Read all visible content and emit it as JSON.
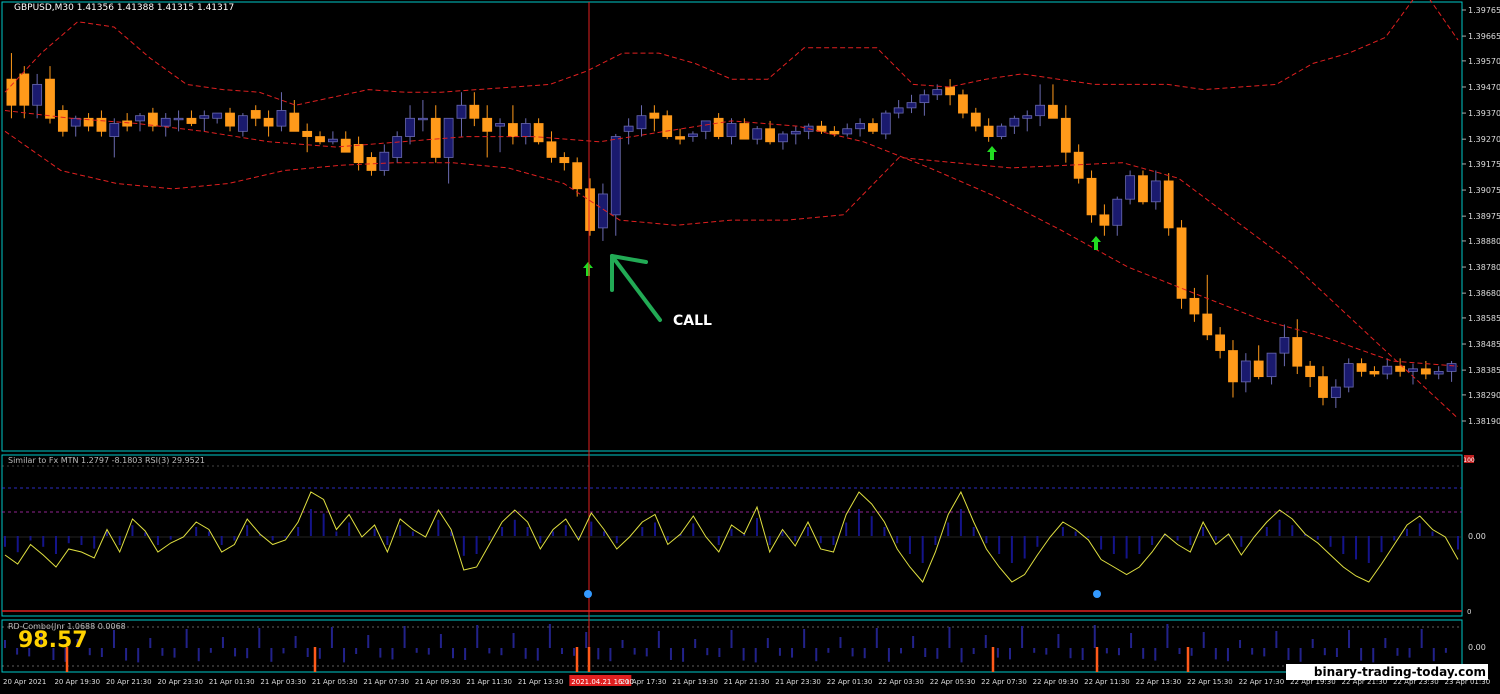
{
  "symbol_header": "GBPUSD,M30  1.41356 1.41388 1.41315 1.41317",
  "call_label": "CALL",
  "watermark": "binary-trading-today.com",
  "sub1_header": "Similar to Fx MTN  1.2797 -8.1803  RSI(3) 29.9521",
  "sub2_header": "RD-Combo(Jnr  1.0688 0.0068",
  "sub2_value": "98.57",
  "price_axis": [
    "1.39765",
    "1.39665",
    "1.39570",
    "1.39470",
    "1.39370",
    "1.39270",
    "1.39175",
    "1.39075",
    "1.38975",
    "1.38880",
    "1.38780",
    "1.38680",
    "1.38585",
    "1.38485",
    "1.38385",
    "1.38290",
    "1.38190"
  ],
  "sub1_axis": [
    "0.00"
  ],
  "sub2_axis": [
    "0.00"
  ],
  "sub1_top_label": "100",
  "sub1_bottom_label": "0",
  "time_axis": [
    "20 Apr 2021",
    "20 Apr 19:30",
    "20 Apr 21:30",
    "20 Apr 23:30",
    "21 Apr 01:30",
    "21 Apr 03:30",
    "21 Apr 05:30",
    "21 Apr 07:30",
    "21 Apr 09:30",
    "21 Apr 11:30",
    "21 Apr 13:30",
    "2021.04.21 16:00",
    "21 Apr 17:30",
    "21 Apr 19:30",
    "21 Apr 21:30",
    "21 Apr 23:30",
    "22 Apr 01:30",
    "22 Apr 03:30",
    "22 Apr 05:30",
    "22 Apr 07:30",
    "22 Apr 09:30",
    "22 Apr 11:30",
    "22 Apr 13:30",
    "22 Apr 15:30",
    "22 Apr 17:30",
    "22 Apr 19:30",
    "22 Apr 21:30",
    "22 Apr 23:30",
    "23 Apr 01:30"
  ],
  "colors": {
    "bull": "#1a1a6e",
    "bear": "#ff9a1a",
    "band": "#e02020",
    "rsi": "#e0e040",
    "grid": "#00c8c8",
    "arrow": "#22dd22",
    "call_arrow": "#22aa55"
  },
  "chart_data": {
    "type": "candlestick",
    "ylim": [
      1.3819,
      1.39765
    ],
    "candles": [
      [
        1.395,
        1.396,
        1.3935,
        1.394
      ],
      [
        1.3952,
        1.3955,
        1.3935,
        1.394
      ],
      [
        1.394,
        1.3952,
        1.3935,
        1.3948
      ],
      [
        1.395,
        1.3955,
        1.3933,
        1.3935
      ],
      [
        1.3938,
        1.394,
        1.3928,
        1.393
      ],
      [
        1.3932,
        1.3936,
        1.3928,
        1.3935
      ],
      [
        1.3935,
        1.3937,
        1.393,
        1.3932
      ],
      [
        1.3935,
        1.3938,
        1.3928,
        1.393
      ],
      [
        1.3928,
        1.3935,
        1.392,
        1.3933
      ],
      [
        1.3934,
        1.3937,
        1.393,
        1.3932
      ],
      [
        1.3934,
        1.3937,
        1.393,
        1.3936
      ],
      [
        1.3937,
        1.3939,
        1.393,
        1.3932
      ],
      [
        1.3932,
        1.3937,
        1.3928,
        1.3935
      ],
      [
        1.3935,
        1.3938,
        1.393,
        1.3935
      ],
      [
        1.3935,
        1.3938,
        1.3932,
        1.3933
      ],
      [
        1.3935,
        1.3938,
        1.393,
        1.3936
      ],
      [
        1.3935,
        1.3937,
        1.3933,
        1.3937
      ],
      [
        1.3937,
        1.3939,
        1.393,
        1.3932
      ],
      [
        1.393,
        1.3937,
        1.3928,
        1.3936
      ],
      [
        1.3938,
        1.394,
        1.3932,
        1.3935
      ],
      [
        1.3935,
        1.3938,
        1.3928,
        1.3932
      ],
      [
        1.3932,
        1.3945,
        1.393,
        1.3938
      ],
      [
        1.3937,
        1.3942,
        1.393,
        1.393
      ],
      [
        1.393,
        1.3933,
        1.3922,
        1.3928
      ],
      [
        1.3928,
        1.393,
        1.3925,
        1.3926
      ],
      [
        1.3926,
        1.393,
        1.3925,
        1.3927
      ],
      [
        1.3927,
        1.393,
        1.3922,
        1.3922
      ],
      [
        1.3925,
        1.3928,
        1.3915,
        1.3918
      ],
      [
        1.392,
        1.3922,
        1.3913,
        1.3915
      ],
      [
        1.3915,
        1.3925,
        1.3913,
        1.3922
      ],
      [
        1.392,
        1.393,
        1.3918,
        1.3928
      ],
      [
        1.3928,
        1.394,
        1.3925,
        1.3935
      ],
      [
        1.3935,
        1.3942,
        1.393,
        1.3935
      ],
      [
        1.3935,
        1.394,
        1.3918,
        1.392
      ],
      [
        1.392,
        1.3935,
        1.391,
        1.3935
      ],
      [
        1.3935,
        1.3945,
        1.3928,
        1.394
      ],
      [
        1.394,
        1.3945,
        1.3932,
        1.3935
      ],
      [
        1.3935,
        1.394,
        1.392,
        1.393
      ],
      [
        1.3932,
        1.3935,
        1.3922,
        1.3933
      ],
      [
        1.3933,
        1.394,
        1.3925,
        1.3928
      ],
      [
        1.3928,
        1.3935,
        1.3925,
        1.3933
      ],
      [
        1.3933,
        1.3935,
        1.3925,
        1.3926
      ],
      [
        1.3926,
        1.393,
        1.3918,
        1.392
      ],
      [
        1.392,
        1.3922,
        1.3915,
        1.3918
      ],
      [
        1.3918,
        1.392,
        1.3905,
        1.3908
      ],
      [
        1.3908,
        1.3912,
        1.389,
        1.3892
      ],
      [
        1.3893,
        1.391,
        1.3888,
        1.3906
      ],
      [
        1.3898,
        1.3929,
        1.389,
        1.3928
      ],
      [
        1.393,
        1.3935,
        1.3925,
        1.3932
      ],
      [
        1.3931,
        1.394,
        1.3928,
        1.3936
      ],
      [
        1.3937,
        1.394,
        1.393,
        1.3935
      ],
      [
        1.3936,
        1.3938,
        1.3927,
        1.3928
      ],
      [
        1.3928,
        1.3931,
        1.3925,
        1.3927
      ],
      [
        1.3928,
        1.393,
        1.3926,
        1.3929
      ],
      [
        1.393,
        1.3934,
        1.3927,
        1.3934
      ],
      [
        1.3935,
        1.3937,
        1.3927,
        1.3928
      ],
      [
        1.3928,
        1.3935,
        1.3925,
        1.3933
      ],
      [
        1.3933,
        1.3935,
        1.3927,
        1.3927
      ],
      [
        1.3927,
        1.3932,
        1.3925,
        1.3931
      ],
      [
        1.3931,
        1.3934,
        1.3925,
        1.3926
      ],
      [
        1.3926,
        1.393,
        1.3923,
        1.3929
      ],
      [
        1.3929,
        1.3932,
        1.3925,
        1.393
      ],
      [
        1.393,
        1.3933,
        1.3927,
        1.3932
      ],
      [
        1.3932,
        1.3934,
        1.3929,
        1.393
      ],
      [
        1.393,
        1.3932,
        1.3928,
        1.3929
      ],
      [
        1.3929,
        1.3933,
        1.3928,
        1.3931
      ],
      [
        1.3931,
        1.3935,
        1.3928,
        1.3933
      ],
      [
        1.3933,
        1.3935,
        1.3929,
        1.393
      ],
      [
        1.3929,
        1.3938,
        1.3927,
        1.3937
      ],
      [
        1.3937,
        1.3942,
        1.3935,
        1.3939
      ],
      [
        1.3939,
        1.3944,
        1.3937,
        1.3941
      ],
      [
        1.3941,
        1.3946,
        1.3936,
        1.3944
      ],
      [
        1.3944,
        1.3948,
        1.3942,
        1.3946
      ],
      [
        1.3947,
        1.395,
        1.394,
        1.3944
      ],
      [
        1.3944,
        1.3946,
        1.3935,
        1.3937
      ],
      [
        1.3937,
        1.3939,
        1.393,
        1.3932
      ],
      [
        1.3932,
        1.3935,
        1.3926,
        1.3928
      ],
      [
        1.3928,
        1.3933,
        1.3927,
        1.3932
      ],
      [
        1.3932,
        1.3936,
        1.3929,
        1.3935
      ],
      [
        1.3935,
        1.3938,
        1.393,
        1.3936
      ],
      [
        1.3936,
        1.3948,
        1.3932,
        1.394
      ],
      [
        1.394,
        1.3948,
        1.3935,
        1.3935
      ],
      [
        1.3935,
        1.394,
        1.3918,
        1.3922
      ],
      [
        1.3922,
        1.3925,
        1.391,
        1.3912
      ],
      [
        1.3912,
        1.3915,
        1.3895,
        1.3898
      ],
      [
        1.3898,
        1.3902,
        1.389,
        1.3894
      ],
      [
        1.3894,
        1.3905,
        1.389,
        1.3904
      ],
      [
        1.3904,
        1.3915,
        1.3902,
        1.3913
      ],
      [
        1.3913,
        1.3915,
        1.3902,
        1.3903
      ],
      [
        1.3903,
        1.3915,
        1.39,
        1.3911
      ],
      [
        1.3911,
        1.3914,
        1.389,
        1.3893
      ],
      [
        1.3893,
        1.3896,
        1.3862,
        1.3866
      ],
      [
        1.3866,
        1.387,
        1.3857,
        1.386
      ],
      [
        1.386,
        1.3875,
        1.385,
        1.3852
      ],
      [
        1.3852,
        1.3855,
        1.3843,
        1.3846
      ],
      [
        1.3846,
        1.385,
        1.3828,
        1.3834
      ],
      [
        1.3834,
        1.3845,
        1.383,
        1.3842
      ],
      [
        1.3842,
        1.3848,
        1.3835,
        1.3836
      ],
      [
        1.3836,
        1.3845,
        1.3833,
        1.3845
      ],
      [
        1.3845,
        1.3856,
        1.384,
        1.3851
      ],
      [
        1.3851,
        1.3858,
        1.3837,
        1.384
      ],
      [
        1.384,
        1.3842,
        1.3832,
        1.3836
      ],
      [
        1.3836,
        1.384,
        1.3825,
        1.3828
      ],
      [
        1.3828,
        1.3835,
        1.3824,
        1.3832
      ],
      [
        1.3832,
        1.3843,
        1.383,
        1.3841
      ],
      [
        1.3841,
        1.3843,
        1.3836,
        1.3838
      ],
      [
        1.3838,
        1.384,
        1.3836,
        1.3837
      ],
      [
        1.3837,
        1.3843,
        1.3835,
        1.384
      ],
      [
        1.384,
        1.3843,
        1.3836,
        1.3838
      ],
      [
        1.3838,
        1.3841,
        1.3833,
        1.3839
      ],
      [
        1.3839,
        1.3842,
        1.3835,
        1.3837
      ],
      [
        1.3837,
        1.384,
        1.3835,
        1.3838
      ],
      [
        1.3838,
        1.3842,
        1.3834,
        1.3841
      ]
    ],
    "band_upper": [
      1.3945,
      1.396,
      1.3972,
      1.397,
      1.3958,
      1.3948,
      1.3946,
      1.3945,
      1.394,
      1.3943,
      1.3946,
      1.3945,
      1.3945,
      1.3946,
      1.3947,
      1.3948,
      1.3953,
      1.396,
      1.396,
      1.3956,
      1.395,
      1.395,
      1.3962,
      1.3962,
      1.3962,
      1.3948,
      1.3947,
      1.395,
      1.3952,
      1.395,
      1.3948,
      1.3948,
      1.3948,
      1.3946,
      1.3947,
      1.3948,
      1.3956,
      1.396,
      1.3966,
      1.3985,
      1.3965
    ],
    "band_lower": [
      1.393,
      1.3915,
      1.391,
      1.3908,
      1.391,
      1.3915,
      1.3917,
      1.3918,
      1.3918,
      1.3916,
      1.391,
      1.3896,
      1.3894,
      1.3896,
      1.3896,
      1.3898,
      1.392,
      1.3918,
      1.3916,
      1.3917,
      1.3918,
      1.3912,
      1.3896,
      1.388,
      1.386,
      1.384,
      1.382
    ],
    "band_mid": [
      1.3938,
      1.3935,
      1.3933,
      1.393,
      1.3926,
      1.3924,
      1.3926,
      1.3928,
      1.3928,
      1.3926,
      1.393,
      1.3934,
      1.3932,
      1.3926,
      1.3916,
      1.3905,
      1.3892,
      1.3878,
      1.3868,
      1.3858,
      1.3851,
      1.3842,
      1.384
    ],
    "rsi": [
      38,
      32,
      45,
      38,
      30,
      42,
      40,
      36,
      55,
      40,
      62,
      54,
      40,
      46,
      50,
      60,
      55,
      40,
      45,
      62,
      52,
      45,
      48,
      60,
      80,
      75,
      55,
      65,
      50,
      58,
      40,
      62,
      55,
      50,
      68,
      55,
      28,
      30,
      45,
      60,
      68,
      60,
      42,
      55,
      62,
      48,
      66,
      55,
      42,
      50,
      60,
      65,
      45,
      52,
      64,
      50,
      40,
      58,
      52,
      70,
      40,
      55,
      44,
      60,
      42,
      40,
      65,
      80,
      72,
      60,
      42,
      30,
      20,
      40,
      65,
      80,
      60,
      42,
      30,
      20,
      25,
      38,
      50,
      60,
      55,
      48,
      35,
      30,
      25,
      30,
      40,
      52,
      45,
      40,
      60,
      45,
      52,
      38,
      50,
      60,
      68,
      62,
      52,
      46,
      38,
      30,
      24,
      20,
      32,
      45,
      58,
      64,
      55,
      50,
      35
    ]
  }
}
